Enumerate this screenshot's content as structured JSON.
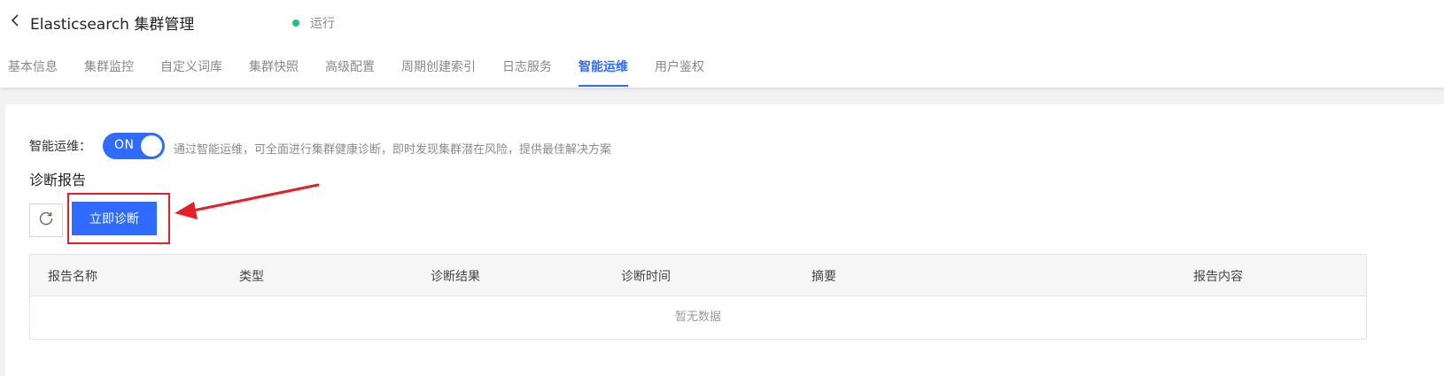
{
  "colors": {
    "accent": "#2f6bff",
    "running": "#19c37d",
    "highlight": "#e3202a"
  },
  "header": {
    "back_icon": "chevron-left-icon",
    "title": "Elasticsearch 集群管理",
    "status": "运行"
  },
  "tabs": [
    {
      "label": "基本信息"
    },
    {
      "label": "集群监控"
    },
    {
      "label": "自定义词库"
    },
    {
      "label": "集群快照"
    },
    {
      "label": "高级配置"
    },
    {
      "label": "周期创建索引"
    },
    {
      "label": "日志服务"
    },
    {
      "label": "智能运维",
      "active": true
    },
    {
      "label": "用户鉴权"
    }
  ],
  "smart_ops": {
    "label": "智能运维：",
    "toggle_text": "ON",
    "enabled": true,
    "description": "通过智能运维，可全面进行集群健康诊断，即时发现集群潜在风险，提供最佳解决方案"
  },
  "report": {
    "title": "诊断报告",
    "refresh_icon": "refresh-icon",
    "diagnose_button": "立即诊断",
    "columns": [
      "报告名称",
      "类型",
      "诊断结果",
      "诊断时间",
      "摘要",
      "报告内容"
    ],
    "empty_text": "暂无数据"
  }
}
